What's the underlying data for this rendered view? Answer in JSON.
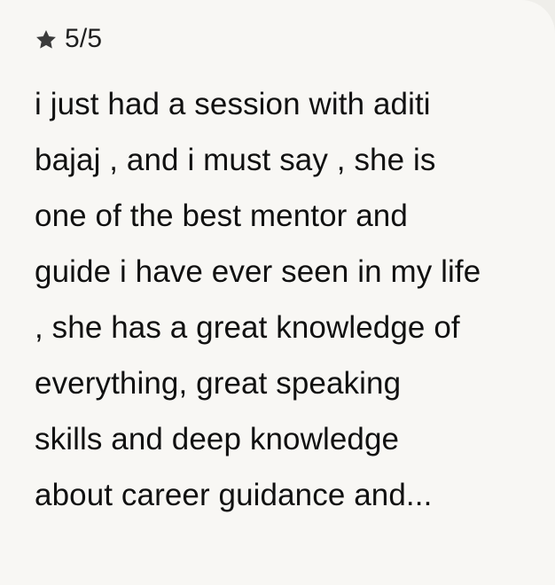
{
  "review_card": {
    "rating": {
      "icon": "star-icon",
      "text": "5/5"
    },
    "review_lines": [
      "i just had a session with aditi",
      "bajaj , and i must say , she is",
      "one of the best mentor and",
      "guide i have ever seen in my life",
      ", she has a great knowledge of",
      "everything, great speaking",
      "skills and deep knowledge",
      "about career guidance and..."
    ]
  },
  "colors": {
    "page_background": "#efeeea",
    "card_background": "#f8f7f4",
    "text": "#111111",
    "star": "#3b3b3b"
  }
}
